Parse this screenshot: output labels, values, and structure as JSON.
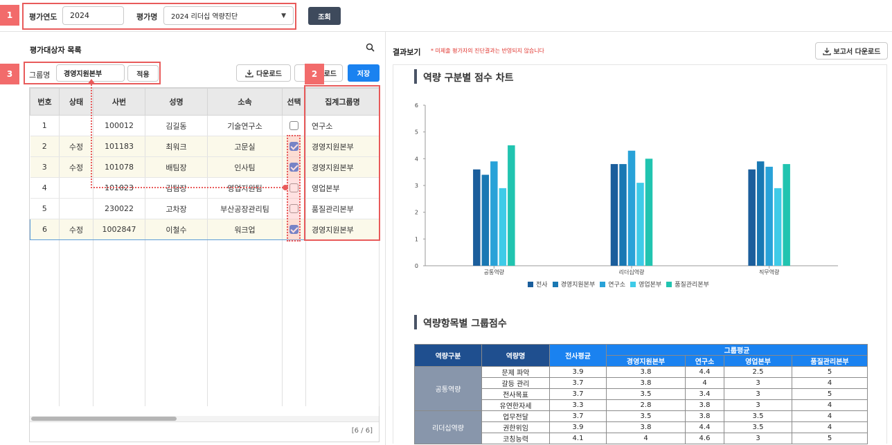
{
  "topbar": {
    "badge1": "1",
    "year_label": "평가연도",
    "year_value": "2024",
    "eval_label": "평가명",
    "eval_value": "2024 리더십 역량진단",
    "search_button": "조회"
  },
  "left": {
    "title": "평가대상자 목록",
    "badge3": "3",
    "badge2": "2",
    "group_label": "그룹명",
    "group_value": "경영지원본부",
    "apply_button": "적용",
    "download_button": "다운로드",
    "hidden_button_text": "로드",
    "save_button": "저장",
    "columns": [
      "번호",
      "상태",
      "사번",
      "성명",
      "소속",
      "선택",
      "집계그룹명"
    ],
    "rows": [
      {
        "no": "1",
        "status": "",
        "emp": "100012",
        "name": "김길동",
        "dept": "기술연구소",
        "checked": false,
        "group": "연구소",
        "modified": false,
        "selected": false
      },
      {
        "no": "2",
        "status": "수정",
        "emp": "101183",
        "name": "최워크",
        "dept": "고문실",
        "checked": true,
        "group": "경영지원본부",
        "modified": true,
        "selected": false
      },
      {
        "no": "3",
        "status": "수정",
        "emp": "101078",
        "name": "배팀장",
        "dept": "인사팀",
        "checked": true,
        "group": "경영지원본부",
        "modified": true,
        "selected": false
      },
      {
        "no": "4",
        "status": "",
        "emp": "101023",
        "name": "김팀장",
        "dept": "영업지원팀",
        "checked": false,
        "group": "영업본부",
        "modified": false,
        "selected": false
      },
      {
        "no": "5",
        "status": "",
        "emp": "230022",
        "name": "고차장",
        "dept": "부산공장관리팀",
        "checked": false,
        "group": "품질관리본부",
        "modified": false,
        "selected": false
      },
      {
        "no": "6",
        "status": "수정",
        "emp": "1002847",
        "name": "이철수",
        "dept": "워크업",
        "checked": true,
        "group": "경영지원본부",
        "modified": true,
        "selected": true
      }
    ],
    "pager": "[6 / 6]"
  },
  "right": {
    "title": "결과보기",
    "note": "* 미제출 평가자의 진단결과는 반영되지 않습니다",
    "report_button": "보고서 다운로드",
    "chart_title": "역량 구분별 점수 차트",
    "table_title": "역량항목별 그룹점수",
    "table": {
      "h_category": "역량구분",
      "h_name": "역량명",
      "h_avg": "전사평균",
      "h_group": "그룹평균",
      "groups": [
        "경영지원본부",
        "연구소",
        "영업본부",
        "품질관리본부"
      ],
      "sections": [
        {
          "category": "공통역량",
          "items": [
            {
              "name": "문제 파악",
              "avg": "3.9",
              "vals": [
                "3.8",
                "4.4",
                "2.5",
                "5"
              ]
            },
            {
              "name": "갈등 관리",
              "avg": "3.7",
              "vals": [
                "3.8",
                "4",
                "3",
                "4"
              ]
            },
            {
              "name": "전사목표",
              "avg": "3.7",
              "vals": [
                "3.5",
                "3.4",
                "3",
                "5"
              ]
            },
            {
              "name": "유연한자세",
              "avg": "3.3",
              "vals": [
                "2.8",
                "3.8",
                "3",
                "4"
              ]
            }
          ]
        },
        {
          "category": "리더십역량",
          "items": [
            {
              "name": "업무전달",
              "avg": "3.7",
              "vals": [
                "3.5",
                "3.8",
                "3.5",
                "4"
              ]
            },
            {
              "name": "권한위임",
              "avg": "3.9",
              "vals": [
                "3.8",
                "4.4",
                "3.5",
                "4"
              ]
            },
            {
              "name": "코칭능력",
              "avg": "4.1",
              "vals": [
                "4",
                "4.6",
                "3",
                "5"
              ]
            }
          ]
        }
      ]
    }
  },
  "chart_data": {
    "type": "bar",
    "categories": [
      "공통역량",
      "리더십역량",
      "직무역량"
    ],
    "series": [
      {
        "name": "전사",
        "color": "#1b5e9c",
        "values": [
          3.6,
          3.8,
          3.6
        ]
      },
      {
        "name": "경영지원본부",
        "color": "#1978b3",
        "values": [
          3.4,
          3.8,
          3.9
        ]
      },
      {
        "name": "연구소",
        "color": "#29a2d8",
        "values": [
          3.9,
          4.3,
          3.7
        ]
      },
      {
        "name": "영업본부",
        "color": "#3fcbe8",
        "values": [
          2.9,
          3.1,
          2.9
        ]
      },
      {
        "name": "품질관리본부",
        "color": "#21c4b0",
        "values": [
          4.5,
          4.0,
          3.8
        ]
      }
    ],
    "ylim": [
      0,
      6
    ],
    "yticks": [
      0,
      1,
      2,
      3,
      4,
      5,
      6
    ],
    "grid": false,
    "legend": "bottom"
  },
  "colors": {
    "accent": "#1a82f0",
    "highlight": "#e85a5a",
    "header_dark": "#1f4f8f"
  }
}
